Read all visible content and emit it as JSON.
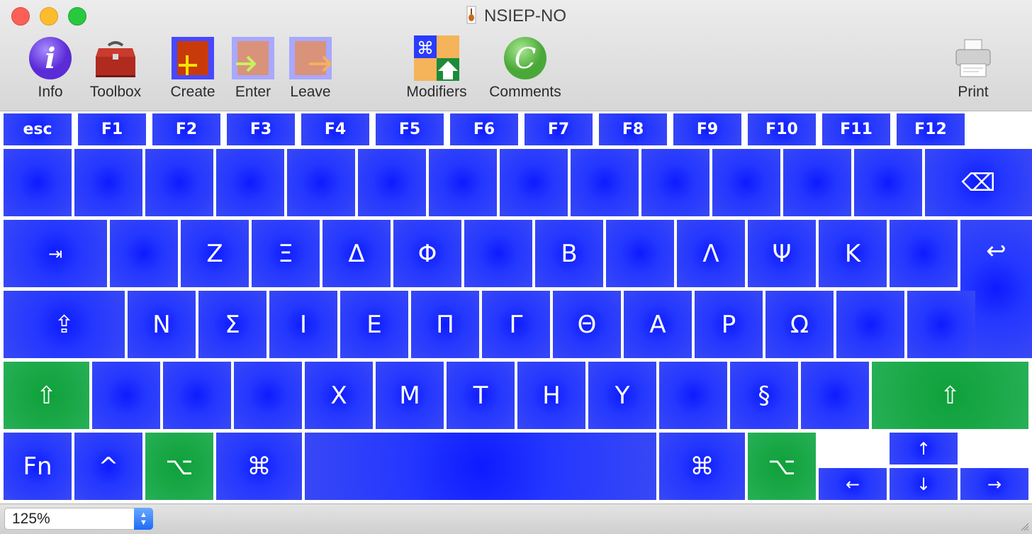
{
  "window": {
    "title": "NSIEP-NO"
  },
  "toolbar": {
    "info_label": "Info",
    "toolbox_label": "Toolbox",
    "create_label": "Create",
    "enter_label": "Enter",
    "leave_label": "Leave",
    "modifiers_label": "Modifiers",
    "comments_label": "Comments",
    "print_label": "Print",
    "info_glyph": "i",
    "comments_glyph": "C"
  },
  "keyboard": {
    "function_row": [
      "esc",
      "F1",
      "F2",
      "F3",
      "F4",
      "F5",
      "F6",
      "F7",
      "F8",
      "F9",
      "F10",
      "F11",
      "F12"
    ],
    "number_row": [
      "",
      "",
      "",
      "",
      "",
      "",
      "",
      "",
      "",
      "",
      "",
      "",
      "",
      "⌫"
    ],
    "top_row": [
      "⇥",
      "",
      "Ζ",
      "Ξ",
      "Δ",
      "Φ",
      "",
      "Β",
      "",
      "Λ",
      "Ψ",
      "Κ",
      "",
      "↩"
    ],
    "home_row": [
      "⇪",
      "Ν",
      "Σ",
      "Ι",
      "Ε",
      "Π",
      "Γ",
      "Θ",
      "Α",
      "Ρ",
      "Ω",
      "",
      ""
    ],
    "bottom_row": [
      "⇧",
      "",
      "",
      "",
      "Χ",
      "Μ",
      "Τ",
      "Η",
      "Υ",
      "",
      "§",
      "",
      "⇧"
    ],
    "modifier_row": [
      "Fn",
      "^",
      "⌥",
      "⌘",
      "",
      "⌘",
      "⌥"
    ],
    "arrows": {
      "up": "↑",
      "left": "←",
      "down": "↓",
      "right": "→"
    }
  },
  "status": {
    "zoom": "125%"
  },
  "colors": {
    "key_blue": "#2437ff",
    "key_green": "#1aa847"
  }
}
